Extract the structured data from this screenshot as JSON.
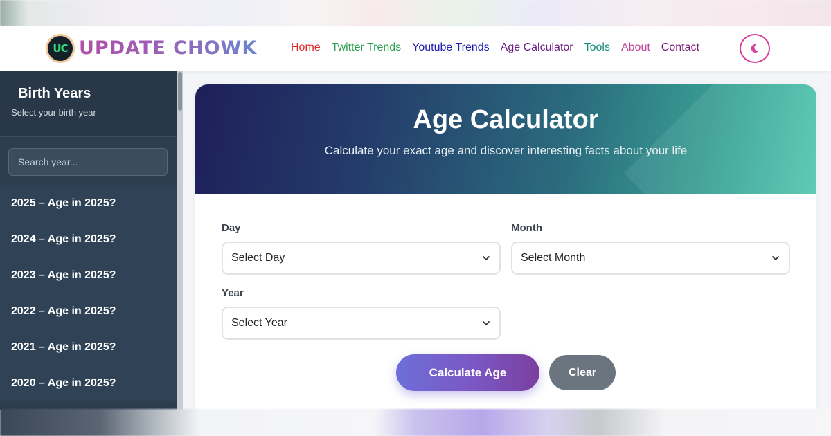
{
  "brand": {
    "logo_initials": "UC",
    "name": "UPDATE CHOWK"
  },
  "nav": {
    "items": [
      {
        "label": "Home",
        "color": "#e02424"
      },
      {
        "label": "Twitter Trends",
        "color": "#2aa052"
      },
      {
        "label": "Youtube Trends",
        "color": "#1d1db0"
      },
      {
        "label": "Age Calculator",
        "color": "#6a1e82"
      },
      {
        "label": "Tools",
        "color": "#148a7a"
      },
      {
        "label": "About",
        "color": "#c0449b"
      },
      {
        "label": "Contact",
        "color": "#7b1778"
      }
    ],
    "theme_toggle_icon": "moon-icon"
  },
  "sidebar": {
    "title": "Birth Years",
    "subtitle": "Select your birth year",
    "search_placeholder": "Search year...",
    "items": [
      {
        "label": "2025 – Age in 2025?"
      },
      {
        "label": "2024 – Age in 2025?"
      },
      {
        "label": "2023 – Age in 2025?"
      },
      {
        "label": "2022 – Age in 2025?"
      },
      {
        "label": "2021 – Age in 2025?"
      },
      {
        "label": "2020 – Age in 2025?"
      }
    ]
  },
  "calculator": {
    "title": "Age Calculator",
    "subtitle": "Calculate your exact age and discover interesting facts about your life",
    "day": {
      "label": "Day",
      "value": "Select Day"
    },
    "month": {
      "label": "Month",
      "value": "Select Month"
    },
    "year": {
      "label": "Year",
      "value": "Select Year"
    },
    "calculate_label": "Calculate Age",
    "clear_label": "Clear"
  }
}
